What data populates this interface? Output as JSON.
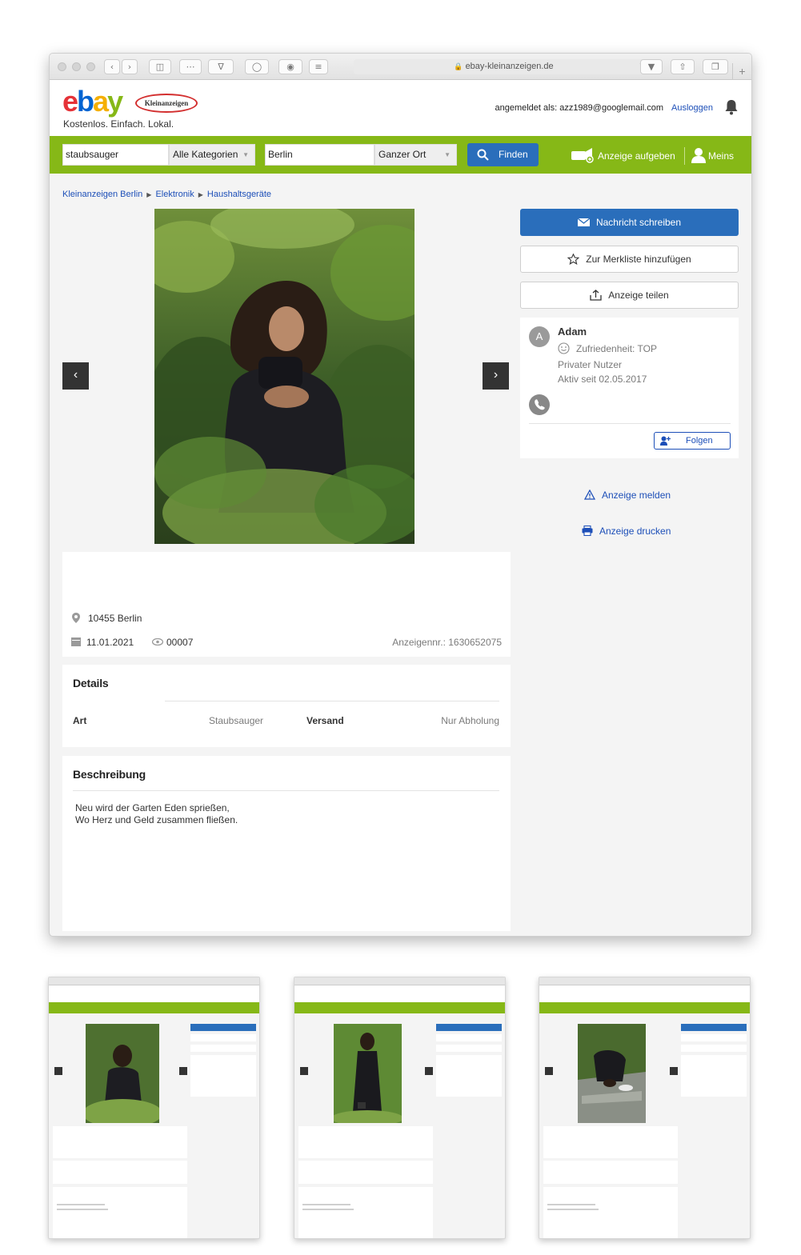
{
  "browser": {
    "url": "ebay-kleinanzeigen.de",
    "new_tab": "+"
  },
  "header": {
    "logo": {
      "e": "e",
      "b": "b",
      "a": "a",
      "y": "y"
    },
    "badge": "Kleinanzeigen",
    "tagline": "Kostenlos. Einfach. Lokal.",
    "logged_in_as": "angemeldet als: azz1989@googlemail.com",
    "logout": "Ausloggen"
  },
  "search": {
    "query": "staubsauger",
    "category": "Alle Kategorien",
    "location": "Berlin",
    "radius": "Ganzer Ort",
    "find_label": "Finden",
    "post_ad_label": "Anzeige aufgeben",
    "account_label": "Meins"
  },
  "breadcrumb": [
    "Kleinanzeigen Berlin",
    "Elektronik",
    "Haushaltsgeräte"
  ],
  "gallery": {
    "prev": "‹",
    "next": "›"
  },
  "ad": {
    "location": "10455 Berlin",
    "date": "11.01.2021",
    "views": "00007",
    "ad_number": "Anzeigennr.: 1630652075"
  },
  "details": {
    "title": "Details",
    "rows": [
      {
        "label": "Art",
        "value": "Staubsauger"
      },
      {
        "label": "Versand",
        "value": "Nur Abholung"
      }
    ]
  },
  "description": {
    "title": "Beschreibung",
    "lines": [
      "Neu wird der Garten Eden sprießen,",
      "Wo Herz und Geld zusammen fließen."
    ]
  },
  "actions": {
    "message": "Nachricht schreiben",
    "watchlist": "Zur Merkliste hinzufügen",
    "share": "Anzeige teilen",
    "report": "Anzeige melden",
    "print": "Anzeige drucken"
  },
  "seller": {
    "initial": "A",
    "name": "Adam",
    "satisfaction": "Zufriedenheit: TOP",
    "type": "Privater Nutzer",
    "active_since": "Aktiv seit 02.05.2017",
    "follow": "Folgen"
  },
  "colors": {
    "green": "#86b817",
    "blue": "#2a6ebb",
    "link": "#1d4fb8"
  }
}
